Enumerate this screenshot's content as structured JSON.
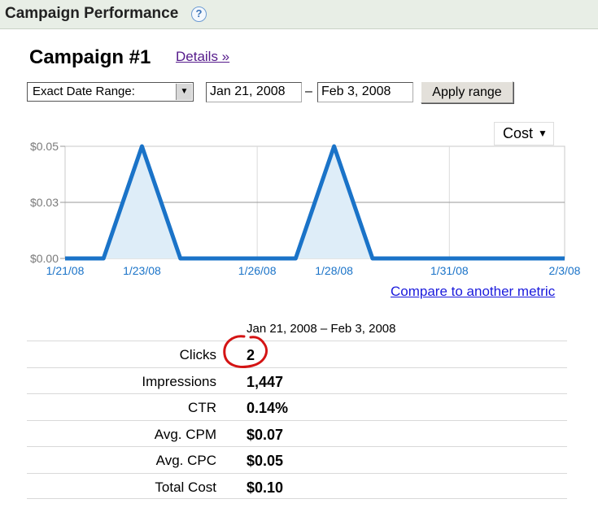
{
  "header": {
    "title": "Campaign Performance",
    "help_icon": "?"
  },
  "campaign": {
    "title": "Campaign #1",
    "details_link": "Details »"
  },
  "range_controls": {
    "select_value": "Exact Date Range:",
    "start_date": "Jan 21, 2008",
    "separator": "–",
    "end_date": "Feb 3, 2008",
    "apply_label": "Apply range"
  },
  "metric_dropdown": {
    "label": "Cost",
    "caret": "▼"
  },
  "chart_data": {
    "type": "area",
    "metric": "Cost",
    "x": [
      "1/21/08",
      "1/22/08",
      "1/23/08",
      "1/24/08",
      "1/25/08",
      "1/26/08",
      "1/27/08",
      "1/28/08",
      "1/29/08",
      "1/30/08",
      "1/31/08",
      "2/1/08",
      "2/2/08",
      "2/3/08"
    ],
    "values": [
      0,
      0,
      0.05,
      0,
      0,
      0,
      0,
      0.05,
      0,
      0,
      0,
      0,
      0,
      0
    ],
    "x_tick_labels": [
      "1/21/08",
      "1/23/08",
      "1/26/08",
      "1/28/08",
      "1/31/08",
      "2/3/08"
    ],
    "y_tick_labels": [
      "$0.05",
      "$0.03",
      "$0.00"
    ],
    "ylim": [
      0,
      0.05
    ],
    "grid": true,
    "colors": {
      "line": "#1a73c8",
      "fill": "#deedf8",
      "grid": "#c8c8c8",
      "axis_text": "#7a7a7a",
      "x_text": "#1a73c8"
    }
  },
  "compare_link": "Compare to another metric",
  "stats": {
    "range_label": "Jan 21, 2008 – Feb 3, 2008",
    "rows": [
      {
        "label": "Clicks",
        "value": "2"
      },
      {
        "label": "Impressions",
        "value": "1,447"
      },
      {
        "label": "CTR",
        "value": "0.14%"
      },
      {
        "label": "Avg. CPM",
        "value": "$0.07"
      },
      {
        "label": "Avg. CPC",
        "value": "$0.05"
      },
      {
        "label": "Total Cost",
        "value": "$0.10"
      }
    ]
  },
  "annotation_color": "#d41414"
}
